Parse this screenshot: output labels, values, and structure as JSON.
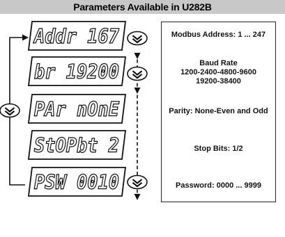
{
  "title": "Parameters Available in U282B",
  "displays": [
    {
      "text": "Addr  167"
    },
    {
      "text": "br 19200"
    },
    {
      "text": "PAr nOnE"
    },
    {
      "text": "StOPbt 2"
    },
    {
      "text": "PSW 0010"
    }
  ],
  "descriptions": [
    {
      "lines": [
        "Modbus Address: 1 ... 247"
      ]
    },
    {
      "lines": [
        "Baud Rate",
        "1200-2400-4800-9600",
        "19200-38400"
      ]
    },
    {
      "lines": [
        "Parity: None-Even and Odd"
      ]
    },
    {
      "lines": [
        "Stop Bits: 1/2"
      ]
    },
    {
      "lines": [
        "Password: 0000 ... 9999"
      ]
    }
  ],
  "icons": {
    "down_button": "down-chevron-button-icon",
    "side_button": "down-chevron-button-icon"
  },
  "colors": {
    "title_bar": "#c8c8c8",
    "ink": "#111111"
  }
}
